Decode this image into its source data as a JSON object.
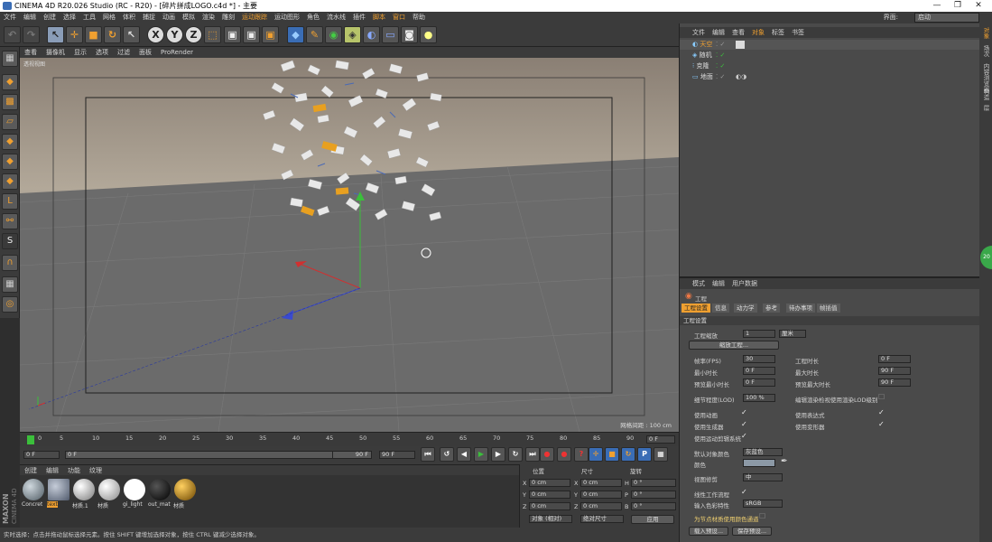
{
  "window": {
    "title": "CINEMA 4D R20.026 Studio (RC - R20) - [碎片拼成LOGO.c4d *] - 主要",
    "min": "—",
    "max": "❐",
    "close": "✕"
  },
  "menubar": {
    "items": [
      "文件",
      "编辑",
      "创建",
      "选择",
      "工具",
      "网格",
      "体积",
      "捕捉",
      "动画",
      "模拟",
      "渲染",
      "雕刻",
      "运动跟踪",
      "运动图形",
      "角色",
      "流水线",
      "插件",
      "脚本",
      "窗口",
      "帮助"
    ],
    "layout_label": "界面:",
    "layout_value": "启动"
  },
  "viewport": {
    "menu": [
      "查看",
      "摄像机",
      "显示",
      "选项",
      "过滤",
      "面板",
      "ProRender"
    ],
    "camera_label": "透视视图",
    "grid_label": "网格间距 : 100 cm"
  },
  "timeline": {
    "ticks": [
      "0",
      "5",
      "10",
      "15",
      "20",
      "25",
      "30",
      "35",
      "40",
      "45",
      "50",
      "55",
      "60",
      "65",
      "70",
      "75",
      "80",
      "85",
      "90"
    ],
    "frame_field": "0 F",
    "start_field": "0 F",
    "min_field": "0 F",
    "end_field": "90 F",
    "max_field": "90 F"
  },
  "materials": {
    "menu": [
      "创建",
      "编辑",
      "功能",
      "纹理"
    ],
    "items": [
      {
        "name": "Concret",
        "color": "#7e8a92"
      },
      {
        "name": "text",
        "color": "#8b95a6"
      },
      {
        "name": "材质.1",
        "color": "#bbbbbb"
      },
      {
        "name": "材质",
        "color": "#c8c8c8"
      },
      {
        "name": "gi_light",
        "color": "#ffffff"
      },
      {
        "name": "out_mat",
        "color": "#111111"
      },
      {
        "name": "材质",
        "color": "#c89010"
      }
    ]
  },
  "coords": {
    "headers": [
      "位置",
      "尺寸",
      "旋转"
    ],
    "rows": [
      {
        "axis": "X",
        "pos": "0 cm",
        "axis2": "X",
        "size": "0 cm",
        "axis3": "H",
        "rot": "0 °"
      },
      {
        "axis": "Y",
        "pos": "0 cm",
        "axis2": "Y",
        "size": "0 cm",
        "axis3": "P",
        "rot": "0 °"
      },
      {
        "axis": "Z",
        "pos": "0 cm",
        "axis2": "Z",
        "size": "0 cm",
        "axis3": "B",
        "rot": "0 °"
      }
    ],
    "mode": "对象 (相对)",
    "size_mode": "绝对尺寸",
    "apply": "应用"
  },
  "status": "实时选择：点击并拖动鼠标选择元素。按住 SHIFT 键增加选择对象，按住 CTRL 键减少选择对象。",
  "objects": {
    "menu": [
      "文件",
      "编辑",
      "查看",
      "对象",
      "标签",
      "书签"
    ],
    "rows": [
      {
        "name": "天空",
        "color": "#f0a030"
      },
      {
        "name": "随机",
        "color": "#dddddd"
      },
      {
        "name": "克隆",
        "color": "#dddddd"
      },
      {
        "name": "地面",
        "color": "#dddddd"
      }
    ]
  },
  "attributes": {
    "menu": [
      "模式",
      "编辑",
      "用户数据"
    ],
    "object_name": "工程",
    "tabs": [
      "工程设置",
      "信息",
      "动力学",
      "参考",
      "待办事项",
      "帧插值"
    ],
    "section": "工程设置",
    "scale_label": "工程缩放",
    "scale_value": "1",
    "scale_unit": "厘米",
    "scale_button": "缩放工程...",
    "fps_label": "帧率(FPS)",
    "fps_value": "30",
    "time_label": "工程时长",
    "time_value": "0 F",
    "min_label": "最小时长",
    "min_value": "0 F",
    "max_label": "最大时长",
    "max_value": "90 F",
    "pmin_label": "预览最小时长",
    "pmin_value": "0 F",
    "pmax_label": "预览最大时长",
    "pmax_value": "90 F",
    "lod_label": "细节程度(LOD)",
    "lod_value": "100 %",
    "lod2_label": "编辑渲染检视使用渲染LOD级别",
    "anim_label": "使用动画",
    "expr_label": "使用表达式",
    "gen_label": "使用生成器",
    "deform_label": "使用变形器",
    "motion_label": "使用运动剪辑系统",
    "objcolor_label": "默认对象颜色",
    "objcolor_value": "灰蓝色",
    "color_label": "颜色",
    "viewclip_label": "视图修剪",
    "viewclip_value": "中",
    "linear_label": "线性工作流程",
    "input_label": "输入色彩特性",
    "input_value": "sRGB",
    "node_label": "为节点材质使用颜色通道",
    "load_button": "载入预设...",
    "save_button": "保存预设..."
  },
  "right_tabs": [
    "对象",
    "场次",
    "内容浏览器",
    "构造",
    "层"
  ],
  "badge": "20"
}
